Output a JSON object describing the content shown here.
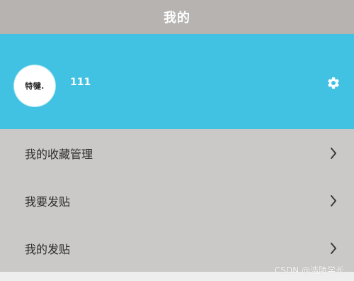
{
  "header": {
    "title": "我的"
  },
  "profile": {
    "avatar_text": "特犍.",
    "username": "111",
    "settings_icon": "gear-icon"
  },
  "menu": {
    "items": [
      {
        "label": "我的收藏管理",
        "icon": "chevron-right-icon"
      },
      {
        "label": "我要发贴",
        "icon": "chevron-right-icon"
      },
      {
        "label": "我的发贴",
        "icon": "chevron-right-icon"
      }
    ]
  },
  "watermark": {
    "text": "CSDN @浩陵学长"
  },
  "colors": {
    "header_bg": "#b6b3b1",
    "profile_bg": "#41c2e2",
    "menu_bg": "#cbc9c7",
    "text": "#2e2e2e"
  }
}
